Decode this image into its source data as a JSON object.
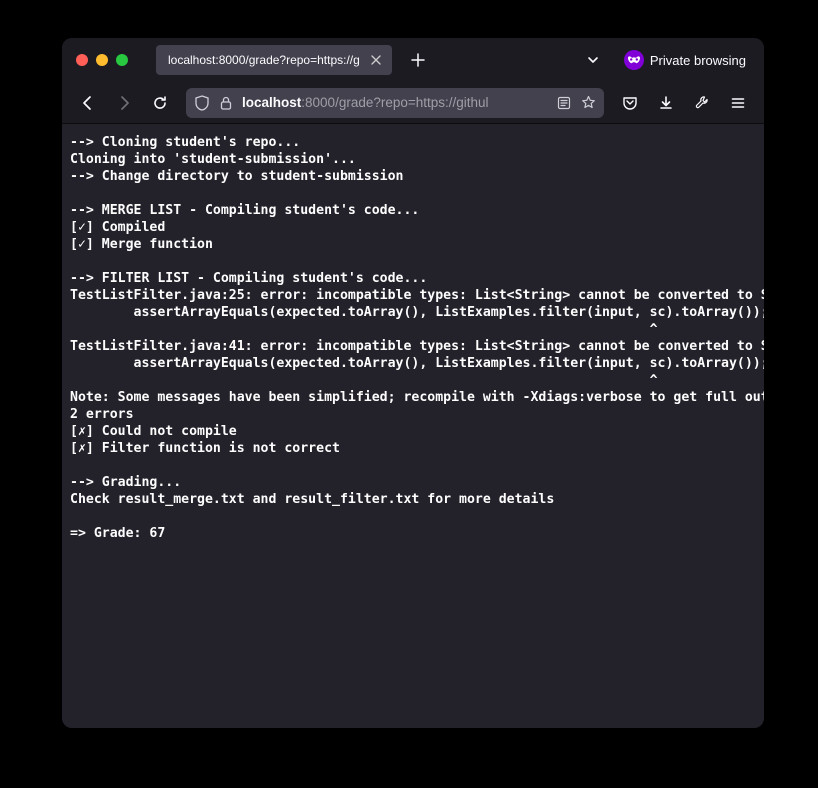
{
  "tab": {
    "title": "localhost:8000/grade?repo=https://g"
  },
  "private": {
    "label": "Private browsing"
  },
  "url": {
    "host": "localhost",
    "port": ":8000",
    "rest": "/grade?repo=https://githul"
  },
  "term": {
    "l01": "--> Cloning student's repo...",
    "l02": "Cloning into 'student-submission'...",
    "l03": "--> Change directory to student-submission",
    "blank": "",
    "l04": "--> MERGE LIST - Compiling student's code...",
    "l05": "[✓] Compiled",
    "l06": "[✓] Merge function",
    "l07": "--> FILTER LIST - Compiling student's code...",
    "l08": "TestListFilter.java:25: error: incompatible types: List<String> cannot be converted to StringChecker",
    "l09": "        assertArrayEquals(expected.toArray(), ListExamples.filter(input, sc).toArray());",
    "l10": "                                                                         ^",
    "l11": "TestListFilter.java:41: error: incompatible types: List<String> cannot be converted to StringChecker",
    "l12": "        assertArrayEquals(expected.toArray(), ListExamples.filter(input, sc).toArray());",
    "l13": "                                                                         ^",
    "l14": "Note: Some messages have been simplified; recompile with -Xdiags:verbose to get full output",
    "l15": "2 errors",
    "l16": "[✗] Could not compile",
    "l17": "[✗] Filter function is not correct",
    "l18": "--> Grading...",
    "l19": "Check result_merge.txt and result_filter.txt for more details",
    "l20": "=> Grade: 67"
  }
}
